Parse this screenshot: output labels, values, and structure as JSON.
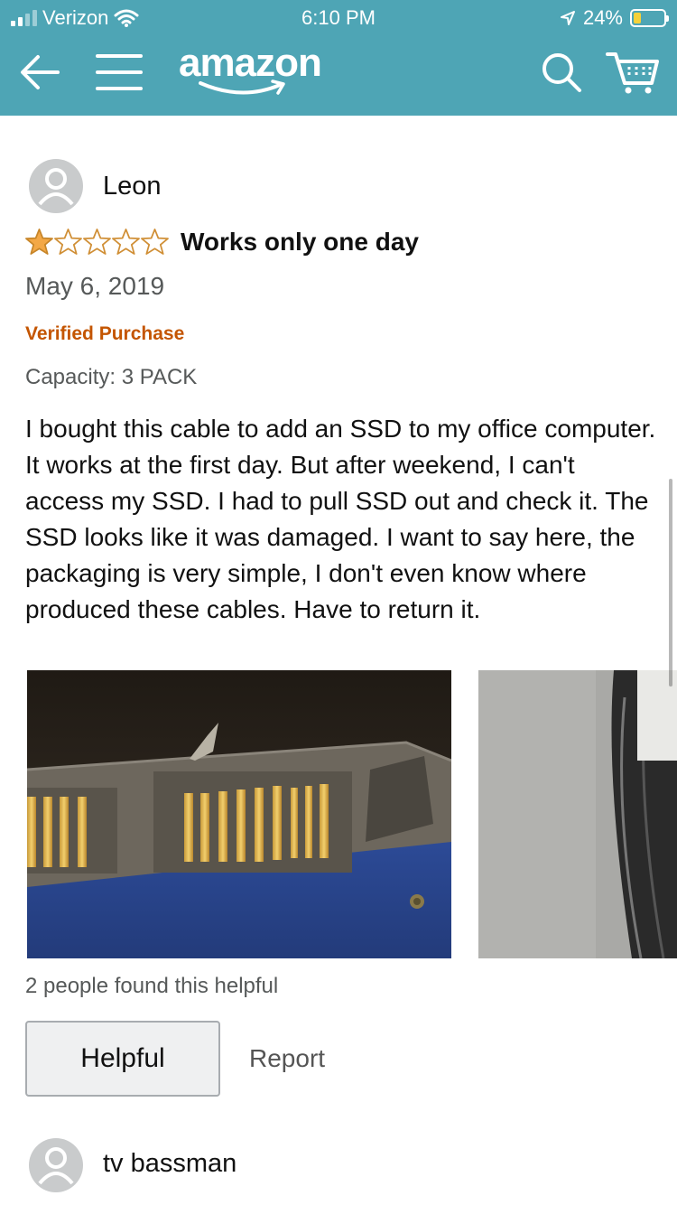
{
  "status_bar": {
    "carrier": "Verizon",
    "time": "6:10 PM",
    "battery_percent": "24%",
    "battery_level": 0.24
  },
  "nav": {
    "logo_text": "amazon",
    "icons": [
      "back-arrow-icon",
      "menu-icon",
      "search-icon",
      "cart-icon"
    ]
  },
  "review": {
    "reviewer_name": "Leon",
    "rating": 1,
    "rating_max": 5,
    "title": "Works only one day",
    "date": "May 6, 2019",
    "verified_label": "Verified Purchase",
    "variant": "Capacity: 3 PACK",
    "body": "I bought this cable to add an SSD to my office computer. It works at the first day. But after weekend, I can't access my SSD. I had to pull SSD out and check it. The SSD looks like it was damaged. I want to say here, the packaging is very simple, I don't even know where produced these cables. Have to return it.",
    "helpful_count_text": "2 people found this helpful",
    "helpful_button_label": "Helpful",
    "report_label": "Report"
  },
  "next_review": {
    "reviewer_name": "tv bassman"
  },
  "colors": {
    "header_bg": "#4ea5b5",
    "star_fill": "#f3a847",
    "verified": "#c45500",
    "muted_text": "#565959"
  }
}
